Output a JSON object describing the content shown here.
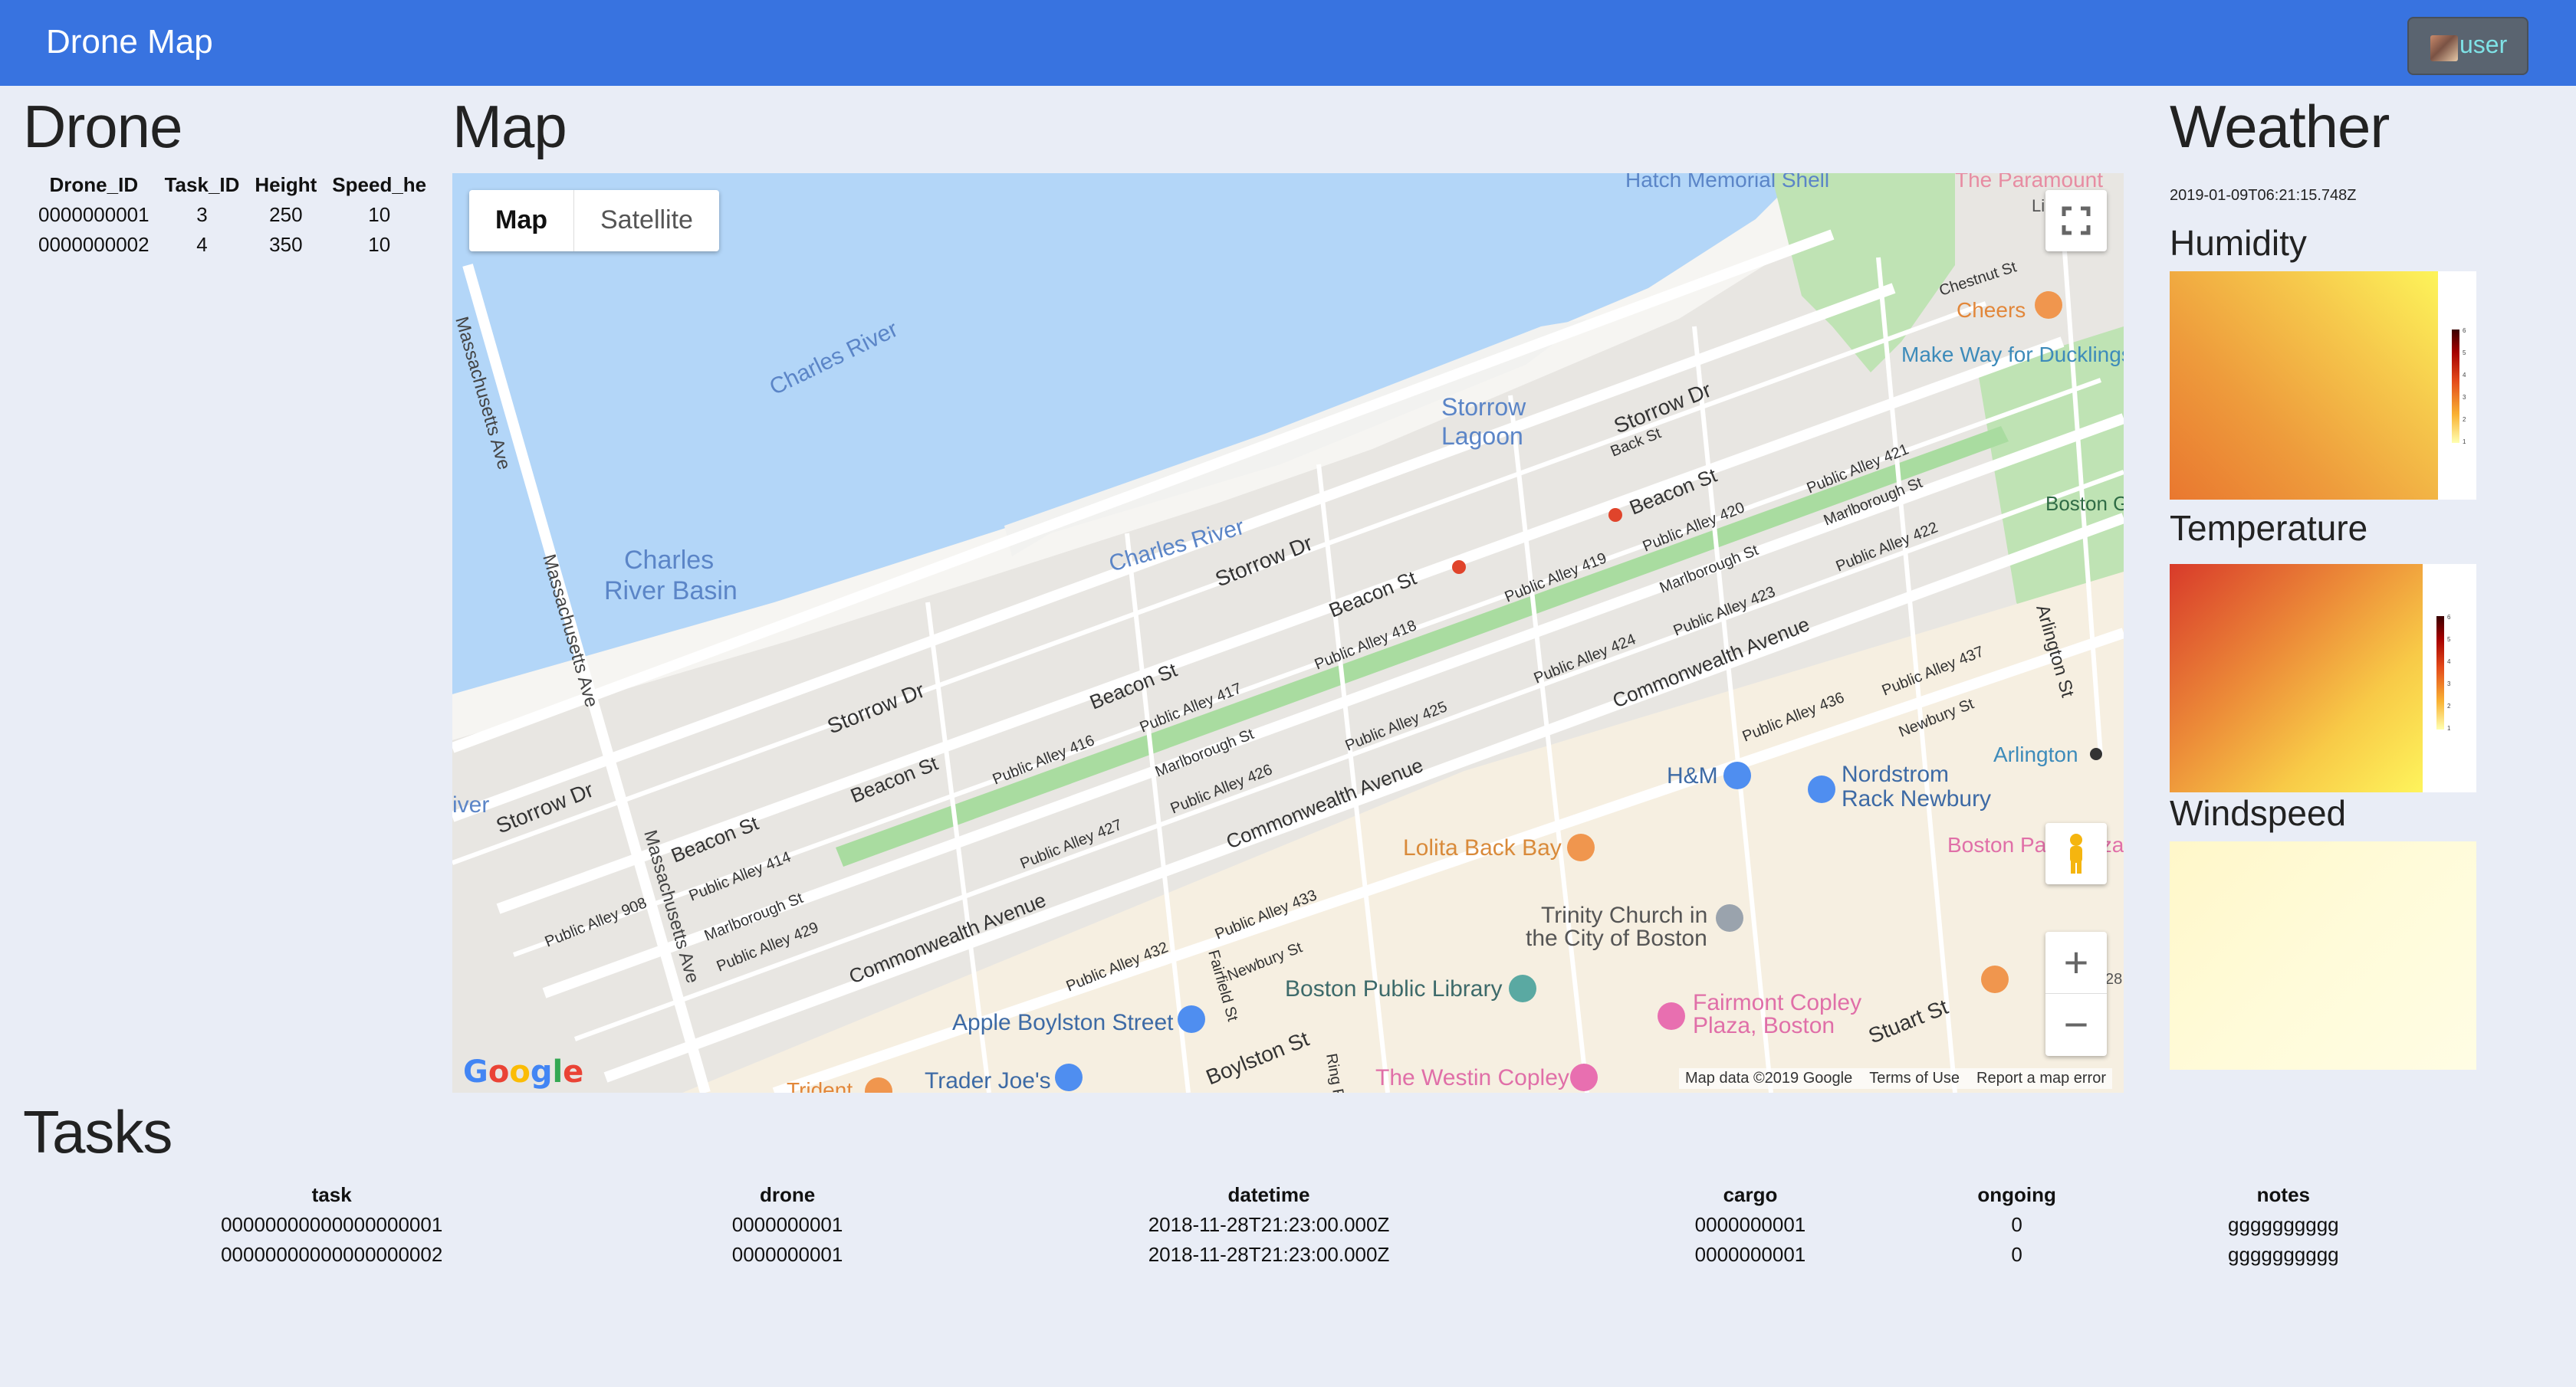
{
  "navbar": {
    "brand": "Drone Map",
    "user_label": "user",
    "avatar_icon": "user-avatar-icon",
    "color": "#3873e0"
  },
  "drone": {
    "title": "Drone",
    "columns": [
      "Drone_ID",
      "Task_ID",
      "Height",
      "Speed_he"
    ],
    "rows": [
      [
        "0000000001",
        "3",
        "250",
        "10"
      ],
      [
        "0000000002",
        "4",
        "350",
        "10"
      ]
    ]
  },
  "map": {
    "title": "Map",
    "type_map": "Map",
    "type_satellite": "Satellite",
    "zoom_in": "+",
    "zoom_out": "−",
    "google": [
      "G",
      "o",
      "o",
      "g",
      "l",
      "e"
    ],
    "attribution": [
      "Map data ©2019 Google",
      "Terms of Use",
      "Report a map error"
    ],
    "labels": {
      "hatch_shell": "Hatch Memorial Shell",
      "paramount": "The Paramount",
      "charles_river_1": "Charles River",
      "charles_river_2": "Charles River",
      "storrow_lagoon_1": "Storrow",
      "storrow_lagoon_2": "Lagoon",
      "charles_basin_1": "Charles",
      "charles_basin_2": "River Basin",
      "mass_ave_1": "Massachusetts Ave",
      "mass_ave_2": "Massachusetts Ave",
      "mass_ave_3": "Massachusetts Ave",
      "storrow_1": "Storrow Dr",
      "storrow_2": "Storrow Dr",
      "storrow_3": "Storrow Dr",
      "storrow_4": "Storrow Dr",
      "beacon_1": "Beacon St",
      "beacon_2": "Beacon St",
      "beacon_3": "Beacon St",
      "beacon_4": "Beacon St",
      "beacon_5": "Beacon St",
      "back_st": "Back St",
      "chestnut": "Chestnut St",
      "cheers": "Cheers",
      "make_way": "Make Way for Ducklings",
      "boston_garden": "Boston Garden",
      "arlington_st": "Arlington St",
      "arlington_stn": "Arlington",
      "pa_421": "Public Alley 421",
      "pa_420": "Public Alley 420",
      "pa_422": "Public Alley 422",
      "pa_419": "Public Alley 419",
      "pa_423": "Public Alley 423",
      "pa_418": "Public Alley 418",
      "pa_417": "Public Alley 417",
      "pa_424": "Public Alley 424",
      "pa_425": "Public Alley 425",
      "pa_416": "Public Alley 416",
      "pa_426": "Public Alley 426",
      "pa_427": "Public Alley 427",
      "pa_414": "Public Alley 414",
      "pa_908": "Public Alley 908",
      "pa_429": "Public Alley 429",
      "pa_432": "Public Alley 432",
      "pa_433": "Public Alley 433",
      "pa_436": "Public Alley 436",
      "pa_437": "Public Alley 437",
      "marl_1": "Marlborough St",
      "marl_2": "Marlborough St",
      "marl_3": "Marlborough St",
      "marl_4": "Marlborough St",
      "comm_1": "Commonwealth Avenue",
      "comm_2": "Commonwealth Avenue",
      "comm_3": "Commonwealth Avenue",
      "newbury_1": "Newbury St",
      "newbury_2": "Newbury St",
      "hm": "H&M",
      "nordstrom_1": "Nordstrom",
      "nordstrom_2": "Rack Newbury",
      "lolita": "Lolita Back Bay",
      "boston_park": "Boston Park Plaza",
      "trinity_1": "Trinity Church in",
      "trinity_2": "the City of Boston",
      "bpl": "Boston Public Library",
      "fairmont_1": "Fairmont Copley",
      "fairmont_2": "Plaza, Boston",
      "stuart": "Stuart St",
      "apple": "Apple Boylston Street",
      "fairfield": "Fairfield St",
      "boylston": "Boylston St",
      "ring": "Ring Rd",
      "westin": "The Westin Copley",
      "trader": "Trader Joe's",
      "trident": "Trident",
      "river_edge": "iver",
      "lib": "Lib",
      "r28": "28"
    }
  },
  "weather": {
    "title": "Weather",
    "timestamp": "2019-01-09T06:21:15.748Z",
    "humidity": "Humidity",
    "temperature": "Temperature",
    "windspeed": "Windspeed",
    "colorbar_ticks": [
      "6",
      "5",
      "4",
      "3",
      "2",
      "1"
    ]
  },
  "tasks": {
    "title": "Tasks",
    "columns": [
      "task",
      "drone",
      "datetime",
      "cargo",
      "ongoing",
      "notes"
    ],
    "rows": [
      [
        "00000000000000000001",
        "0000000001",
        "2018-11-28T21:23:00.000Z",
        "0000000001",
        "0",
        "gggggggggg"
      ],
      [
        "00000000000000000002",
        "0000000001",
        "2018-11-28T21:23:00.000Z",
        "0000000001",
        "0",
        "gggggggggg"
      ]
    ]
  }
}
